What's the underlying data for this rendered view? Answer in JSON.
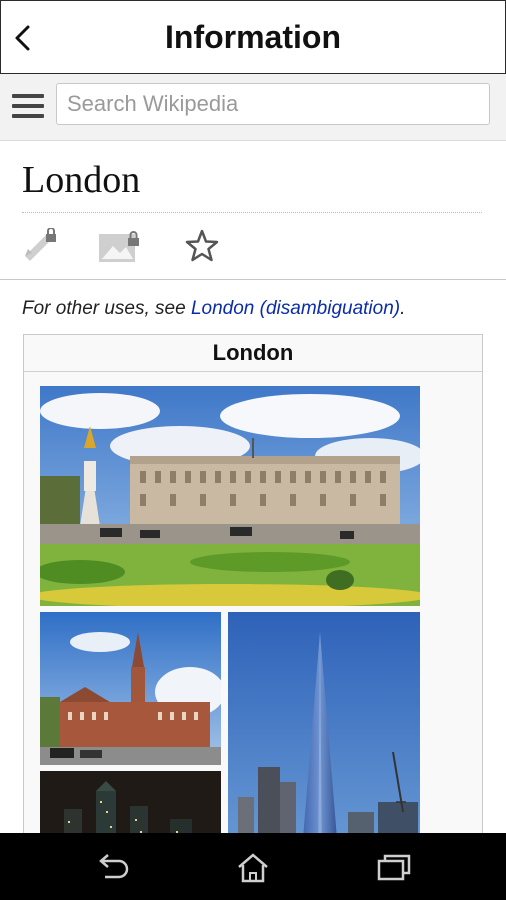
{
  "app_bar": {
    "title": "Information"
  },
  "search": {
    "placeholder": "Search Wikipedia"
  },
  "article": {
    "title": "London",
    "hatnote_prefix": "For other uses, see ",
    "hatnote_link": "London (disambiguation)",
    "hatnote_suffix": "."
  },
  "infobox": {
    "title": "London"
  },
  "icons": {
    "back": "chevron-left-icon",
    "menu": "hamburger-menu-icon",
    "edit": "locked-pencil-icon",
    "image": "locked-image-icon",
    "watch": "star-outline-icon",
    "nav_back": "back-arrow-icon",
    "nav_home": "home-icon",
    "nav_recent": "recent-apps-icon"
  },
  "colors": {
    "link": "#0b2ca8",
    "nav_bar": "#000000",
    "search_bar": "#f2f2f2"
  }
}
